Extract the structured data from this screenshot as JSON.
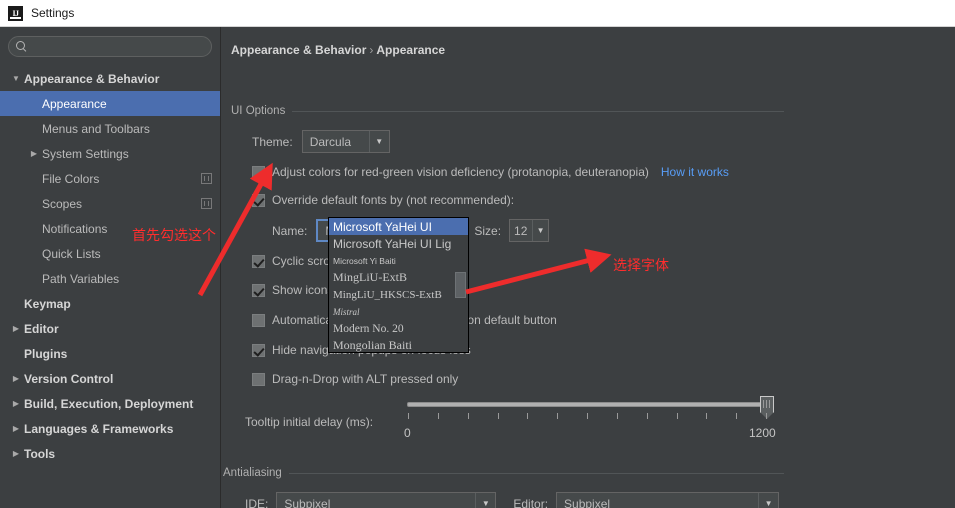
{
  "window": {
    "title": "Settings",
    "logo_icon": "intellij-idea-logo-icon"
  },
  "sidebar": {
    "search": {
      "value": "",
      "placeholder": "",
      "icon": "search-icon"
    },
    "items": [
      {
        "label": "Appearance & Behavior",
        "indent": 0,
        "twisty": "▼",
        "bold": true,
        "selected": false,
        "icon": null
      },
      {
        "label": "Appearance",
        "indent": 1,
        "twisty": "",
        "bold": false,
        "selected": true,
        "icon": null
      },
      {
        "label": "Menus and Toolbars",
        "indent": 1,
        "twisty": "",
        "bold": false,
        "selected": false,
        "icon": null
      },
      {
        "label": "System Settings",
        "indent": 1,
        "twisty": "▶",
        "bold": false,
        "selected": false,
        "icon": null
      },
      {
        "label": "File Colors",
        "indent": 1,
        "twisty": "",
        "bold": false,
        "selected": false,
        "icon": "copy-icon"
      },
      {
        "label": "Scopes",
        "indent": 1,
        "twisty": "",
        "bold": false,
        "selected": false,
        "icon": "copy-icon"
      },
      {
        "label": "Notifications",
        "indent": 1,
        "twisty": "",
        "bold": false,
        "selected": false,
        "icon": null
      },
      {
        "label": "Quick Lists",
        "indent": 1,
        "twisty": "",
        "bold": false,
        "selected": false,
        "icon": null
      },
      {
        "label": "Path Variables",
        "indent": 1,
        "twisty": "",
        "bold": false,
        "selected": false,
        "icon": null
      },
      {
        "label": "Keymap",
        "indent": 0,
        "twisty": "",
        "bold": true,
        "selected": false,
        "icon": null
      },
      {
        "label": "Editor",
        "indent": 0,
        "twisty": "▶",
        "bold": true,
        "selected": false,
        "icon": null
      },
      {
        "label": "Plugins",
        "indent": 0,
        "twisty": "",
        "bold": true,
        "selected": false,
        "icon": null
      },
      {
        "label": "Version Control",
        "indent": 0,
        "twisty": "▶",
        "bold": true,
        "selected": false,
        "icon": null
      },
      {
        "label": "Build, Execution, Deployment",
        "indent": 0,
        "twisty": "▶",
        "bold": true,
        "selected": false,
        "icon": null
      },
      {
        "label": "Languages & Frameworks",
        "indent": 0,
        "twisty": "▶",
        "bold": true,
        "selected": false,
        "icon": null
      },
      {
        "label": "Tools",
        "indent": 0,
        "twisty": "▶",
        "bold": true,
        "selected": false,
        "icon": null
      }
    ]
  },
  "main": {
    "breadcrumb": {
      "root": "Appearance & Behavior",
      "separator": "›",
      "leaf": "Appearance"
    },
    "groups": {
      "ui_options": "UI Options",
      "antialiasing": "Antialiasing"
    },
    "theme": {
      "label": "Theme:",
      "value": "Darcula",
      "arrow": "▼"
    },
    "checkboxes": [
      {
        "label": "Adjust colors for red-green vision deficiency (protanopia, deuteranopia)",
        "checked": false
      },
      {
        "label": "Override default fonts by (not recommended):",
        "checked": true
      },
      {
        "label": "Cyclic scrolling in lists",
        "checked": true
      },
      {
        "label": "Show icons in quick navigation",
        "checked": true
      },
      {
        "label": "Automatically position mouse cursor on default button",
        "checked": false
      },
      {
        "label": "Hide navigation popups on focus loss",
        "checked": true
      },
      {
        "label": "Drag-n-Drop with ALT pressed only",
        "checked": false
      }
    ],
    "how_it_works_link": "How it works",
    "font": {
      "name_label": "Name:",
      "name_value": "Microsoft YaHei UI",
      "size_label": "Size:",
      "size_value": "12",
      "arrow": "▼"
    },
    "font_dropdown": {
      "items": [
        "Microsoft YaHei UI",
        "Microsoft YaHei UI Lig",
        "Microsoft Yi Baiti",
        "MingLiU-ExtB",
        "MingLiU_HKSCS-ExtB",
        "Mistral",
        "Modern No. 20",
        "Mongolian Baiti"
      ],
      "selected_index": 0
    },
    "tooltip_slider": {
      "label": "Tooltip initial delay (ms):",
      "min_label": "0",
      "max_label": "1200",
      "min": 0,
      "max": 1200,
      "value": 1200,
      "tick_count": 13
    },
    "antialiasing": {
      "ide_label": "IDE:",
      "ide_value": "Subpixel",
      "editor_label": "Editor:",
      "editor_value": "Subpixel",
      "arrow": "▼"
    }
  },
  "annotations": {
    "note1": "首先勾选这个",
    "note2": "选择字体",
    "color": "#ff2d2d"
  }
}
